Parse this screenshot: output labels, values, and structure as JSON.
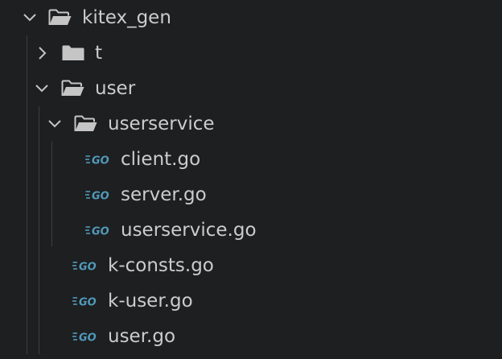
{
  "explorer": {
    "items": [
      {
        "label": "kitex_gen",
        "kind": "folder",
        "expanded": true,
        "depth": 0,
        "icon": "folder-open-icon"
      },
      {
        "label": "t",
        "kind": "folder",
        "expanded": false,
        "depth": 1,
        "icon": "folder-icon"
      },
      {
        "label": "user",
        "kind": "folder",
        "expanded": true,
        "depth": 1,
        "icon": "folder-open-icon"
      },
      {
        "label": "userservice",
        "kind": "folder",
        "expanded": true,
        "depth": 2,
        "icon": "folder-open-icon"
      },
      {
        "label": "client.go",
        "kind": "file",
        "depth": 3,
        "icon": "go-file-icon"
      },
      {
        "label": "server.go",
        "kind": "file",
        "depth": 3,
        "icon": "go-file-icon"
      },
      {
        "label": "userservice.go",
        "kind": "file",
        "depth": 3,
        "icon": "go-file-icon"
      },
      {
        "label": "k-consts.go",
        "kind": "file",
        "depth": 2,
        "icon": "go-file-icon"
      },
      {
        "label": "k-user.go",
        "kind": "file",
        "depth": 2,
        "icon": "go-file-icon"
      },
      {
        "label": "user.go",
        "kind": "file",
        "depth": 2,
        "icon": "go-file-icon"
      }
    ],
    "colors": {
      "background": "#1e1f21",
      "text": "#cccccc",
      "folder_icon": "#c5c5c5",
      "go_icon": "#519aba",
      "indent_guide": "#3d3e40"
    }
  }
}
